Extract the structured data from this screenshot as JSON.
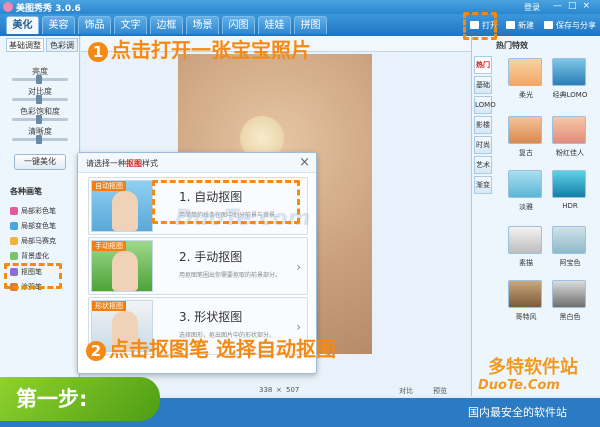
{
  "app": {
    "title": "美图秀秀 3.0.6",
    "login": "登录"
  },
  "window_controls": {
    "min": "—",
    "max": "□",
    "close": "×"
  },
  "main_tabs": [
    {
      "label": "美化",
      "active": true
    },
    {
      "label": "美容"
    },
    {
      "label": "饰品"
    },
    {
      "label": "文字"
    },
    {
      "label": "边框"
    },
    {
      "label": "场景"
    },
    {
      "label": "闪图"
    },
    {
      "label": "娃娃"
    },
    {
      "label": "拼图"
    }
  ],
  "toolbar": {
    "open": "打开",
    "new": "新建",
    "save_share": "保存与分享"
  },
  "left_panel": {
    "subtab_basic": "基础调整",
    "subtab_color": "色彩调",
    "sliders": [
      "亮度",
      "对比度",
      "色彩饱和度",
      "清晰度"
    ],
    "one_key": "一键美化",
    "category_label": "各种画笔",
    "tools": [
      "局部彩色笔",
      "局部变色笔",
      "局部马赛克",
      "背景虚化",
      "抠图笔",
      "涂鸦笔"
    ]
  },
  "canvas": {
    "size_w": "338",
    "size_x": "×",
    "size_h": "507",
    "compare": "对比",
    "preview": "预览",
    "watermark": "DuoTe.com"
  },
  "right_panel": {
    "header": "热门特效",
    "tabs": [
      "热门",
      "基础",
      "LOMO",
      "影楼",
      "时尚",
      "艺术",
      "渐变"
    ],
    "effects": [
      "柔光",
      "经典LOMO",
      "复古",
      "粉红佳人",
      "淡雅",
      "HDR",
      "素描",
      "阿宝色",
      "哥特风",
      "黑白色"
    ]
  },
  "dialog": {
    "title_prefix": "请选择一种",
    "title_highlight": "抠图",
    "title_suffix": "样式",
    "close": "×",
    "options": [
      {
        "tag": "自动抠图",
        "name": "1. 自动抠图",
        "desc": "用简单的线条在图中划分前景与背景..."
      },
      {
        "tag": "手动抠图",
        "name": "2. 手动抠图",
        "desc": "用抠图笔圈出你需要抠取的前景部分。"
      },
      {
        "tag": "形状抠图",
        "name": "3. 形状抠图",
        "desc": "选择图形，抠出图片中的形状部分。"
      }
    ]
  },
  "annotations": {
    "step1_num": "1",
    "step1": "点击打开一张宝宝照片",
    "step2_num": "2",
    "step2": "点击抠图笔 选择自动抠图",
    "banner": "第一步:"
  },
  "watermarks": {
    "brand": "多特软件站",
    "site": "DuoTe.Com",
    "tagline": "国内最安全的软件站"
  },
  "colors": {
    "accent": "#f58a13",
    "titlebar": "#2a86cf",
    "banner": "#6bbd1e"
  }
}
